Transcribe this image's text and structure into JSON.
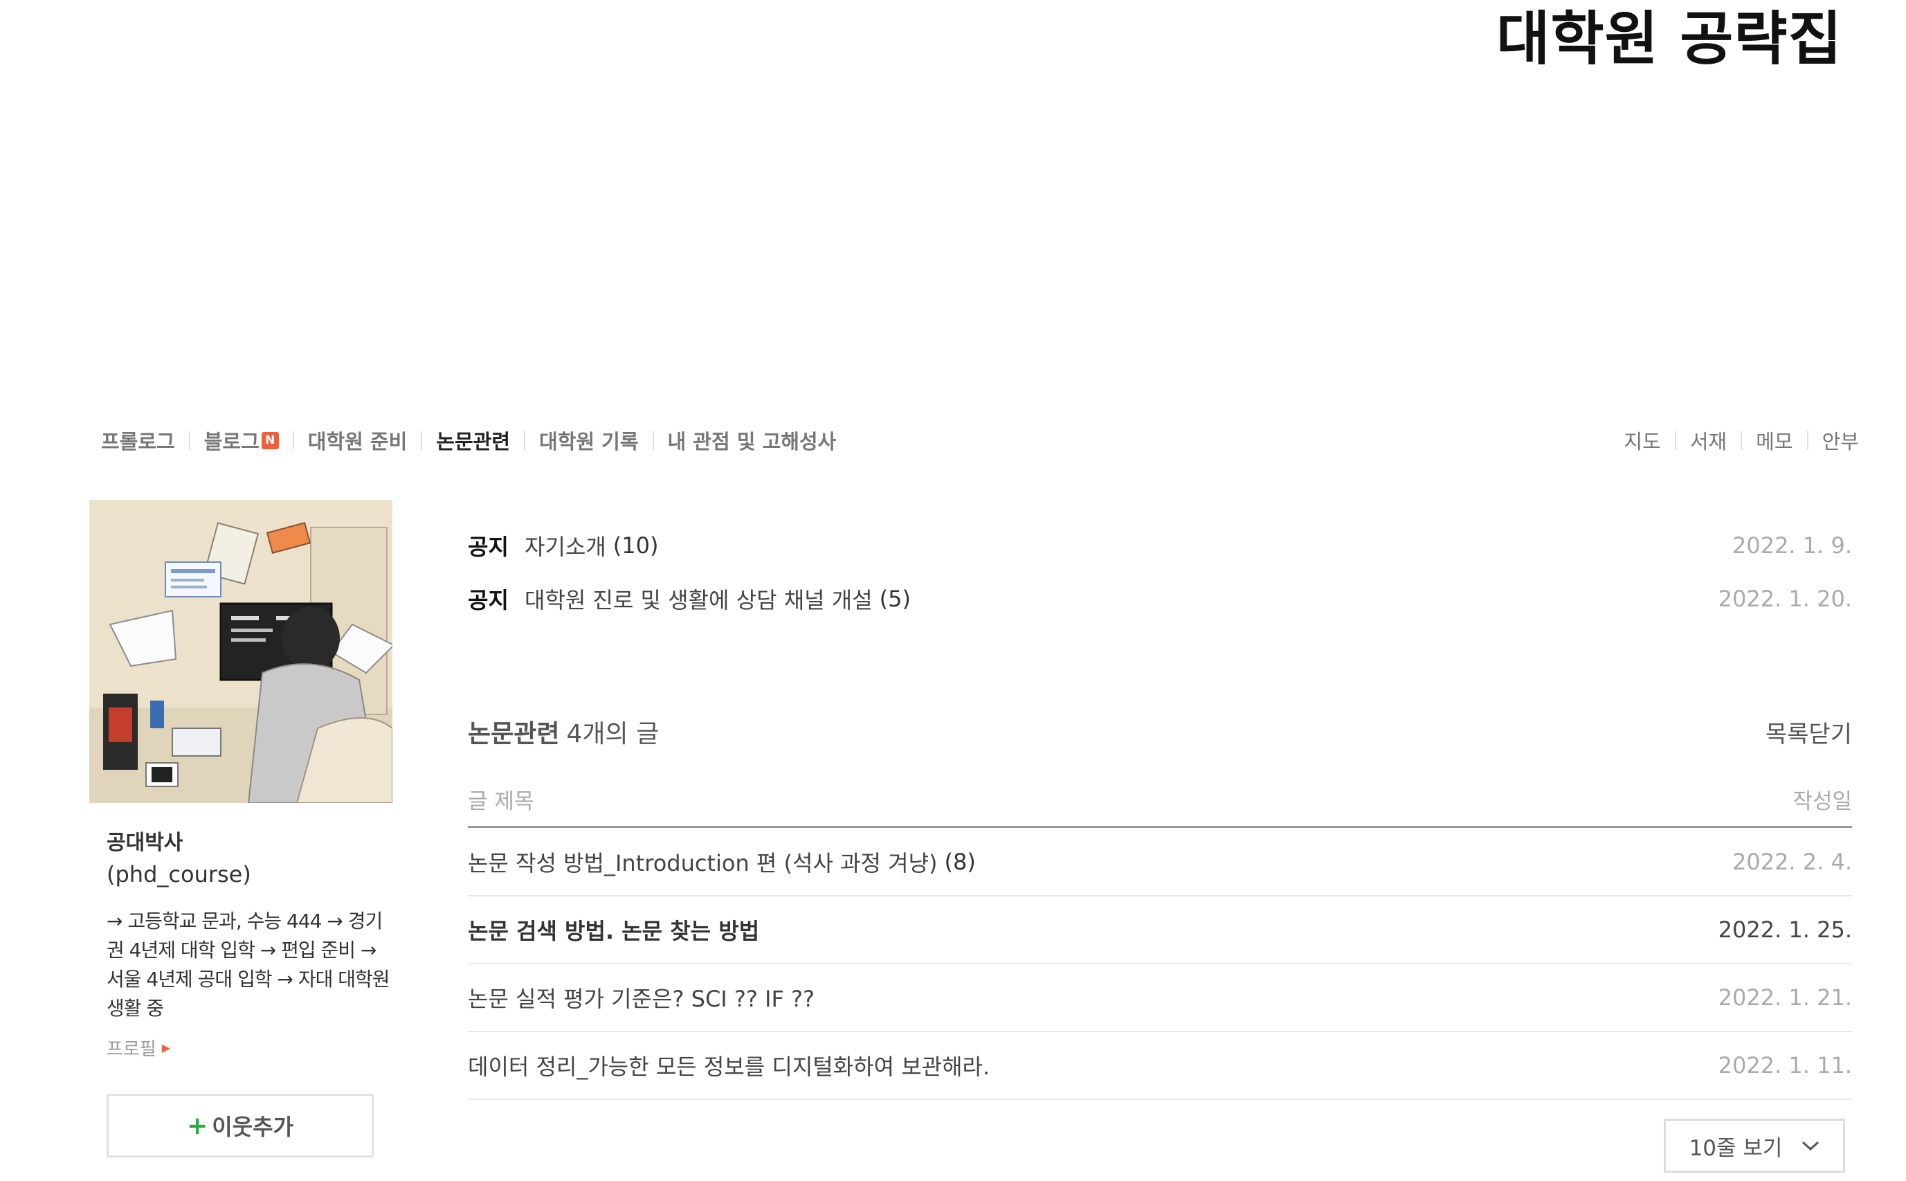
{
  "blog": {
    "title": "대학원 공략집"
  },
  "menu": {
    "items": [
      {
        "label": "프롤로그",
        "badge": ""
      },
      {
        "label": "블로그",
        "badge": "N"
      },
      {
        "label": "대학원 준비",
        "badge": ""
      },
      {
        "label": "논문관련",
        "badge": ""
      },
      {
        "label": "대학원 기록",
        "badge": ""
      },
      {
        "label": "내 관점 및 고해성사",
        "badge": ""
      }
    ],
    "active": "논문관련",
    "tools": [
      "지도",
      "서재",
      "메모",
      "안부"
    ]
  },
  "profile": {
    "nickname": "공대박사",
    "blog_id": "(phd_course)",
    "intro": "→ 고등학교 문과, 수능 444 → 경기권 4년제 대학 입학 → 편입 준비 → 서울 4년제 공대 입학 → 자대 대학원 생활 중",
    "profile_link": "프로필",
    "neighbor_button": "이웃추가"
  },
  "notices": [
    {
      "tag": "공지",
      "title": "자기소개",
      "comments": "(10)",
      "date": "2022. 1. 9."
    },
    {
      "tag": "공지",
      "title": "대학원 진로 및 생활에 상담 채널 개설",
      "comments": "(5)",
      "date": "2022. 1. 20."
    }
  ],
  "post_list": {
    "category": "논문관련",
    "count_label": "4개의 글",
    "close_label": "목록닫기",
    "col_title": "글 제목",
    "col_date": "작성일",
    "posts": [
      {
        "title": "논문 작성 방법_Introduction 편 (석사 과정 겨냥)",
        "comments": "(8)",
        "date": "2022. 2. 4.",
        "current": false
      },
      {
        "title": "논문 검색 방법. 논문 찾는 방법",
        "comments": "",
        "date": "2022. 1. 25.",
        "current": true
      },
      {
        "title": "논문 실적 평가 기준은? SCI ?? IF ??",
        "comments": "",
        "date": "2022. 1. 21.",
        "current": false
      },
      {
        "title": "데이터 정리_가능한 모든 정보를 디지털화하여 보관해라.",
        "comments": "",
        "date": "2022. 1. 11.",
        "current": false
      }
    ],
    "page_size_label": "10줄 보기"
  },
  "colors": {
    "accent_new": "#f05f3a",
    "neighbor_plus": "#19b33b"
  },
  "icons": {
    "neighbor": "plus-icon",
    "page_size": "chevron-down-icon",
    "profile_link": "caret-right-icon"
  }
}
